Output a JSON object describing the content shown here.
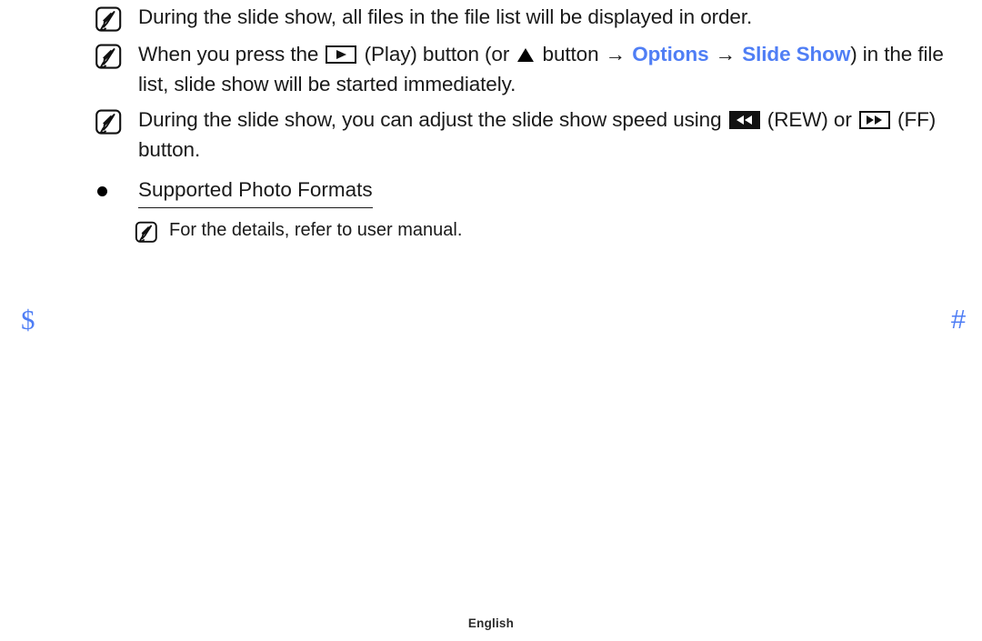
{
  "page": {
    "notes": [
      {
        "icon": "note-pen-icon",
        "segments": [
          {
            "type": "text",
            "value": "During the slide show, all files in the file list will be displayed in order."
          }
        ]
      },
      {
        "icon": "note-pen-icon",
        "segments": [
          {
            "type": "text",
            "value": "When you press the "
          },
          {
            "type": "glyph",
            "value": "play-button-icon"
          },
          {
            "type": "text",
            "value": " (Play) button (or "
          },
          {
            "type": "glyph",
            "value": "up-arrow-icon"
          },
          {
            "type": "text",
            "value": " button "
          },
          {
            "type": "arrow",
            "value": "→"
          },
          {
            "type": "blue",
            "value": " Options "
          },
          {
            "type": "arrow",
            "value": "→"
          },
          {
            "type": "blue",
            "value": " Slide Show"
          },
          {
            "type": "text",
            "value": ") in the file list, slide show will be started immediately."
          }
        ]
      },
      {
        "icon": "note-pen-icon",
        "segments": [
          {
            "type": "text",
            "value": "During the slide show, you can adjust the slide show speed using "
          },
          {
            "type": "glyph",
            "value": "rewind-button-icon"
          },
          {
            "type": "text",
            "value": " (REW) or "
          },
          {
            "type": "glyph",
            "value": "fast-forward-button-icon"
          },
          {
            "type": "text",
            "value": " (FF) button."
          }
        ]
      }
    ],
    "bullet_heading": {
      "bullet": "bullet-dot-icon",
      "label": "Supported Photo Formats"
    },
    "sub_note": {
      "icon": "note-pen-icon",
      "text": "For the details, refer to user manual."
    },
    "corner_markers": {
      "left": "$",
      "right": "#"
    },
    "footer": {
      "language": "English"
    },
    "colors": {
      "accent_blue": "#4f7ef5",
      "text": "#1a1a1a",
      "background": "#ffffff"
    }
  }
}
